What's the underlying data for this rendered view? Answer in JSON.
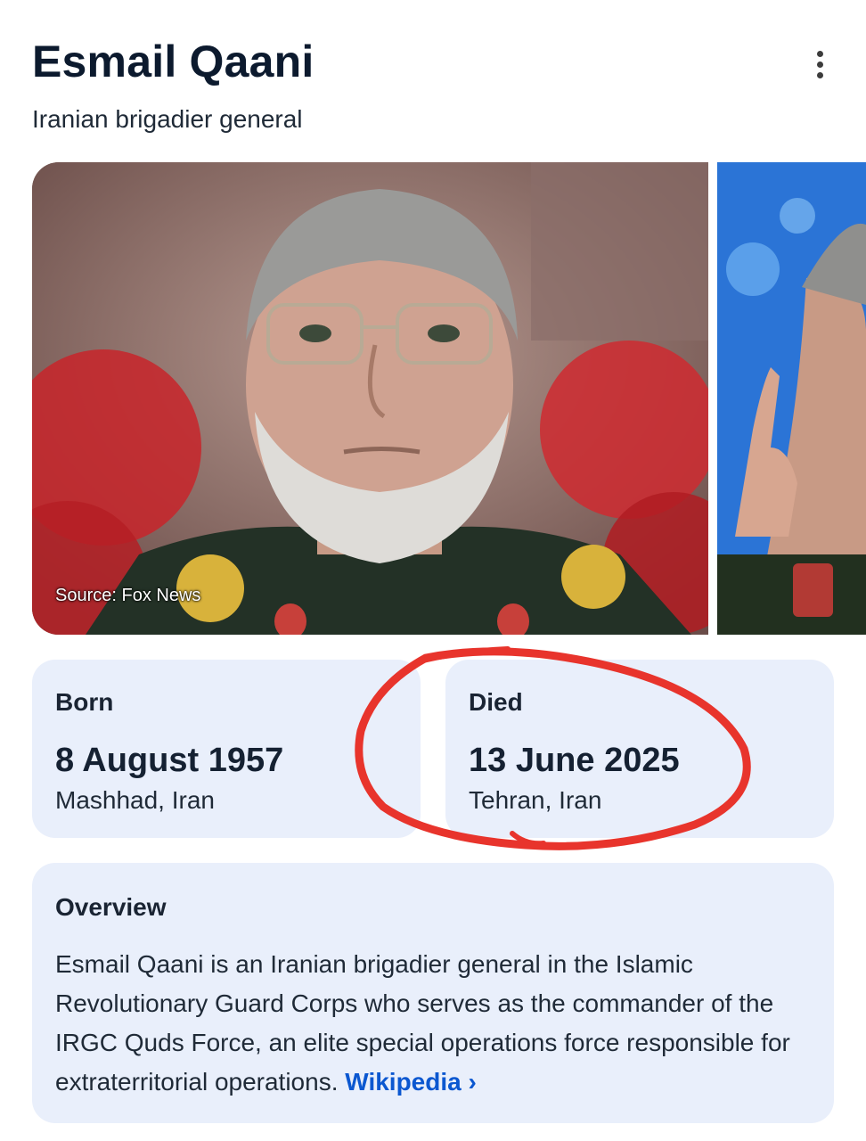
{
  "header": {
    "title": "Esmail Qaani",
    "subtitle": "Iranian brigadier general"
  },
  "images": {
    "main_source": "Source: Fox News"
  },
  "facts": {
    "born": {
      "label": "Born",
      "date": "8 August 1957",
      "place": "Mashhad, Iran"
    },
    "died": {
      "label": "Died",
      "date": "13 June 2025",
      "place": "Tehran, Iran"
    }
  },
  "overview": {
    "heading": "Overview",
    "text": "Esmail Qaani is an Iranian brigadier general in the Islamic Revolutionary Guard Corps who serves as the commander of the IRGC Quds Force, an elite special operations force responsible for extraterritorial operations.",
    "link_label": "Wikipedia",
    "link_chevron": "›"
  },
  "colors": {
    "card_background": "#e9effb",
    "link": "#0b57d0",
    "annotation_circle": "#e8342c"
  },
  "icons": {
    "menu": "more-vert-icon"
  }
}
